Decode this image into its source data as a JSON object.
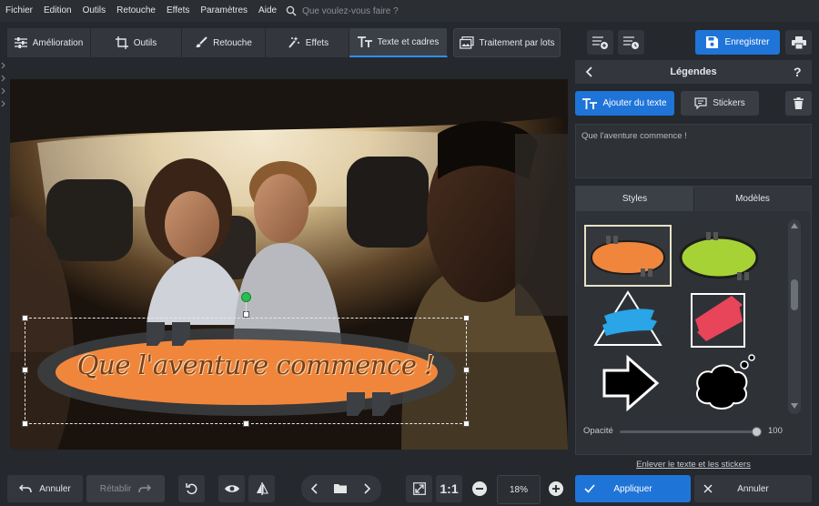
{
  "menu": [
    "Fichier",
    "Edition",
    "Outils",
    "Retouche",
    "Effets",
    "Paramètres",
    "Aide"
  ],
  "search": {
    "placeholder": "Que voulez-vous faire ?"
  },
  "tabs": [
    {
      "label": "Amélioration"
    },
    {
      "label": "Outils"
    },
    {
      "label": "Retouche"
    },
    {
      "label": "Effets"
    },
    {
      "label": "Texte et cadres"
    },
    {
      "label": "Traitement par lots"
    }
  ],
  "toolbar": {
    "save_label": "Enregistrer"
  },
  "panel": {
    "title": "Légendes",
    "help": "?",
    "add_text": "Ajouter du texte",
    "stickers": "Stickers",
    "text_value": "Que l'aventure commence !",
    "styles_tab": "Styles",
    "models_tab": "Modèles",
    "opacity_label": "Opacité",
    "opacity_value": "100",
    "opacity_level": 1.0,
    "remove_link": "Enlever le texte et les stickers",
    "apply": "Appliquer",
    "cancel": "Annuler"
  },
  "canvas": {
    "caption": "Que l'aventure commence !"
  },
  "bottom": {
    "undo": "Annuler",
    "redo": "Rétablir",
    "one_to_one": "1:1",
    "zoom": "18%"
  },
  "colors": {
    "accent": "#1f74d8",
    "caption_bubble": "#f0863c",
    "caption_text": "#7a3e17"
  }
}
